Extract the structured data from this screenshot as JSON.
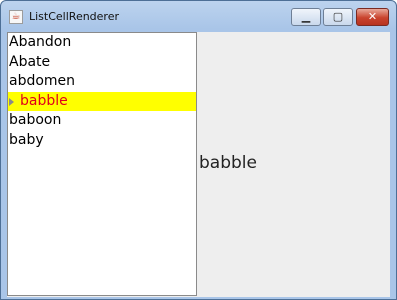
{
  "window": {
    "title": "ListCellRenderer",
    "icon": "java-icon",
    "controls": {
      "minimize": "▁",
      "maximize": "▢",
      "close": "✕"
    }
  },
  "list": {
    "items": [
      {
        "label": "Abandon"
      },
      {
        "label": "Abate"
      },
      {
        "label": "abdomen"
      },
      {
        "label": "babble"
      },
      {
        "label": "baboon"
      },
      {
        "label": "baby"
      }
    ],
    "selected_label": "babble",
    "selection_colors": {
      "background": "#ffff00",
      "text": "#e0001b"
    }
  },
  "detail": {
    "text": "babble"
  }
}
